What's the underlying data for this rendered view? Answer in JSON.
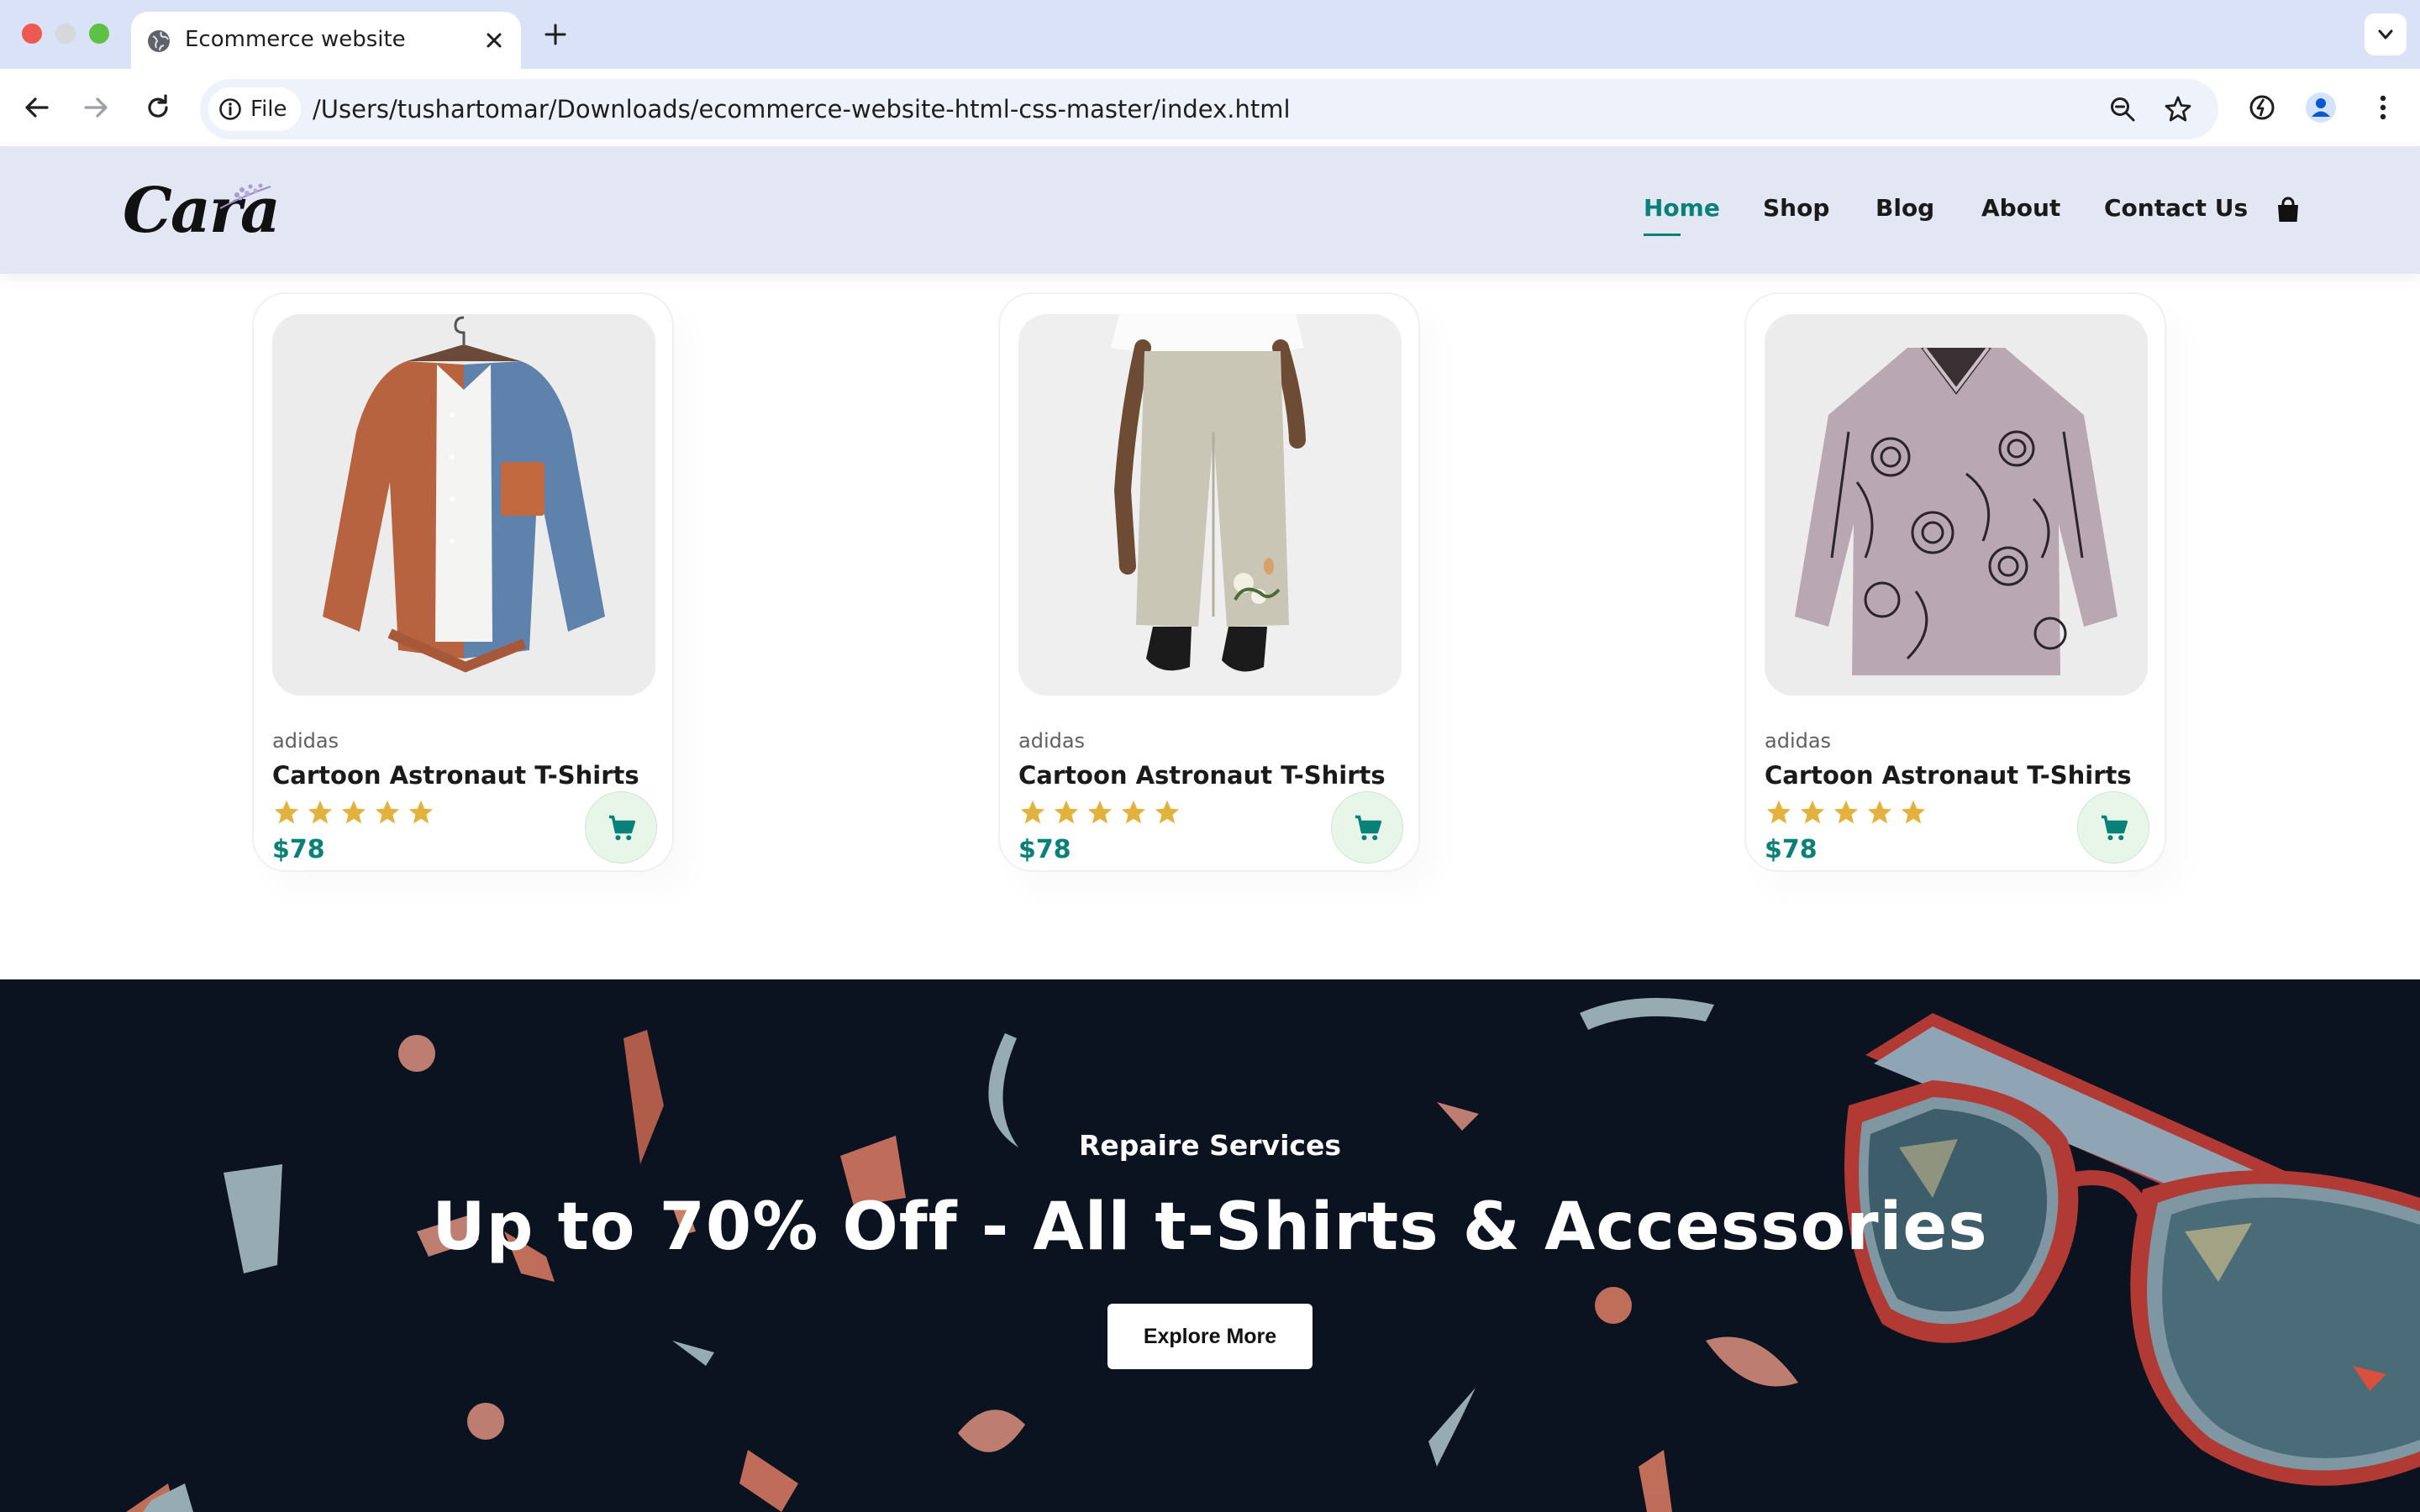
{
  "browser": {
    "tab_title": "Ecommerce website",
    "file_chip": "File",
    "url": "/Users/tushartomar/Downloads/ecommerce-website-html-css-master/index.html"
  },
  "site": {
    "logo": "Cara",
    "nav": [
      "Home",
      "Shop",
      "Blog",
      "About",
      "Contact Us"
    ],
    "active_nav": "Home",
    "accent_color": "#088178",
    "header_bg": "#e3e6f3"
  },
  "products": [
    {
      "brand": "adidas",
      "name": "Cartoon Astronaut T-Shirts",
      "rating": 5,
      "price": "$78",
      "image": "corduroy-shirt"
    },
    {
      "brand": "adidas",
      "name": "Cartoon Astronaut T-Shirts",
      "rating": 5,
      "price": "$78",
      "image": "linen-pants"
    },
    {
      "brand": "adidas",
      "name": "Cartoon Astronaut T-Shirts",
      "rating": 5,
      "price": "$78",
      "image": "printed-blouse"
    }
  ],
  "banner": {
    "subtitle": "Repaire Services",
    "title": "Up to 70% Off - All t-Shirts & Accessories",
    "button": "Explore More",
    "bg_color": "#0b1220"
  }
}
